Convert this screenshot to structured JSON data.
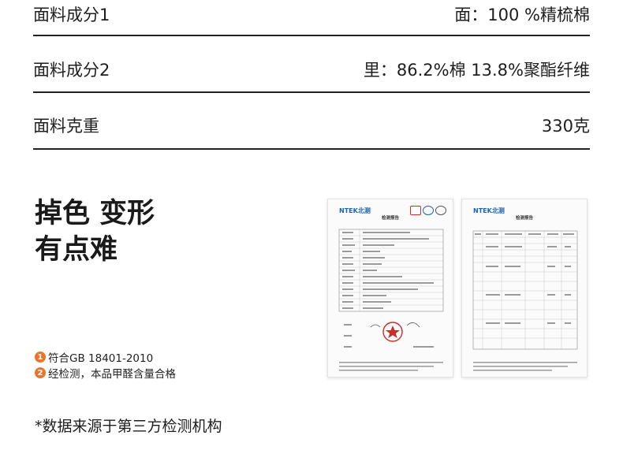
{
  "specs": [
    {
      "key": "面料成分1",
      "value": "面：100 %精梳棉"
    },
    {
      "key": "面料成分2",
      "value": "里：86.2%棉 13.8%聚酯纤维"
    },
    {
      "key": "面料克重",
      "value": "330克"
    }
  ],
  "headline": {
    "line1": "掉色 变形",
    "line2": "有点难"
  },
  "notes": [
    {
      "num": "1",
      "text": "符合GB 18401-2010"
    },
    {
      "num": "2",
      "text": "经检测，本品甲醛含量合格"
    }
  ],
  "reports": [
    {
      "brand": "NTEK北测",
      "title": "检测报告"
    },
    {
      "brand": "NTEK北测",
      "title": "检测报告"
    }
  ],
  "footnote": "*数据来源于第三方检测机构",
  "colors": {
    "accent": "#e8762d",
    "brand_blue": "#1b62b5",
    "stamp_red": "#c4302b"
  }
}
